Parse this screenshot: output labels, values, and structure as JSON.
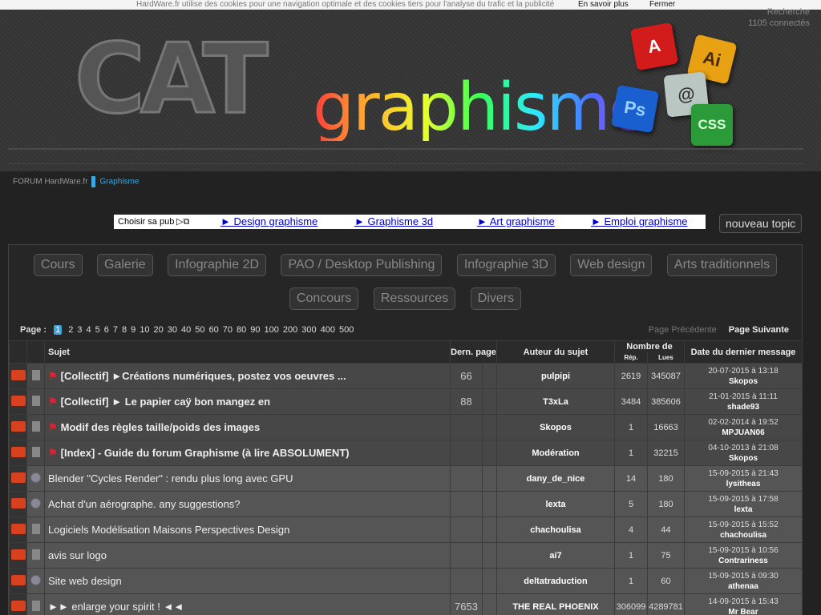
{
  "cookie": {
    "message": "HardWare.fr utilise des cookies pour une navigation optimale et des cookies tiers pour l'analyse du trafic et la publicité",
    "more_label": "En savoir plus",
    "close_label": "Fermer"
  },
  "ghost_nav": {
    "search": "Recherche",
    "connected": "1105 connectés"
  },
  "banner": {
    "logo_cat": "CAT",
    "logo_text": "graphisme",
    "tiles": {
      "pdf": "A",
      "ai": "Ai",
      "ps": "Ps",
      "three_d": "@",
      "css": "CSS"
    }
  },
  "breadcrumb": {
    "root": "FORUM HardWare.fr",
    "current": "Graphisme"
  },
  "pub": {
    "choose_label": "Choisir sa pub",
    "links": [
      "► Design graphisme",
      "► Graphisme 3d",
      "► Art graphisme",
      "► Emploi graphisme"
    ]
  },
  "new_topic_label": "nouveau topic",
  "categories": [
    "Cours",
    "Galerie",
    "Infographie 2D",
    "PAO / Desktop Publishing",
    "Infographie 3D",
    "Web design",
    "Arts traditionnels",
    "Concours",
    "Ressources",
    "Divers"
  ],
  "pagination": {
    "label": "Page :",
    "current": "1",
    "pages": [
      "2",
      "3",
      "4",
      "5",
      "6",
      "7",
      "8",
      "9",
      "10",
      "20",
      "30",
      "40",
      "50",
      "60",
      "70",
      "80",
      "90",
      "100",
      "200",
      "300",
      "400",
      "500"
    ],
    "prev_label": "Page Précédente",
    "next_label": "Page Suivante"
  },
  "table": {
    "headers": {
      "subject": "Sujet",
      "last_page": "Dern. page",
      "author": "Auteur du sujet",
      "count": "Nombre de",
      "replies": "Rép.",
      "reads": "Lues",
      "last_msg": "Date du dernier message"
    },
    "rows": [
      {
        "pinned": true,
        "subject": "[Collectif] ►Créations numériques, postez vos oeuvres ...",
        "last_page": "66",
        "author": "pulpipi",
        "replies": "2619",
        "reads": "345087",
        "date": "20-07-2015 à 13:18",
        "by": "Skopos"
      },
      {
        "pinned": true,
        "subject": "[Collectif] ► Le papier caÿ bon mangez en",
        "last_page": "88",
        "author": "T3xLa",
        "replies": "3484",
        "reads": "385606",
        "date": "21-01-2015 à 11:11",
        "by": "shade93"
      },
      {
        "pinned": true,
        "subject": "Modif des règles taille/poids des images",
        "last_page": "",
        "author": "Skopos",
        "replies": "1",
        "reads": "16663",
        "date": "02-02-2014 à 19:52",
        "by": "MPJUAN06"
      },
      {
        "pinned": true,
        "subject": "[Index] - Guide du forum Graphisme (à lire ABSOLUMENT)",
        "last_page": "",
        "author": "Modération",
        "replies": "1",
        "reads": "32215",
        "date": "04-10-2013 à 21:08",
        "by": "Skopos"
      },
      {
        "pinned": false,
        "subject": "Blender \"Cycles Render\" : rendu plus long avec GPU",
        "last_page": "",
        "author": "dany_de_nice",
        "replies": "14",
        "reads": "180",
        "date": "15-09-2015 à 21:43",
        "by": "lysitheas"
      },
      {
        "pinned": false,
        "subject": "Achat d'un aérographe. any suggestions?",
        "last_page": "",
        "author": "lexta",
        "replies": "5",
        "reads": "180",
        "date": "15-09-2015 à 17:58",
        "by": "lexta"
      },
      {
        "pinned": false,
        "subject": "Logiciels Modélisation Maisons Perspectives Design",
        "last_page": "",
        "author": "chachoulisa",
        "replies": "4",
        "reads": "44",
        "date": "15-09-2015 à 15:52",
        "by": "chachoulisa"
      },
      {
        "pinned": false,
        "subject": "avis sur logo",
        "last_page": "",
        "author": "ai7",
        "replies": "1",
        "reads": "75",
        "date": "15-09-2015 à 10:56",
        "by": "Contrariness"
      },
      {
        "pinned": false,
        "subject": "Site web design",
        "last_page": "",
        "author": "deltatraduction",
        "replies": "1",
        "reads": "60",
        "date": "15-09-2015 à 09:30",
        "by": "athenaa"
      },
      {
        "pinned": false,
        "subject": "►► enlarge your spirit ! ◄◄",
        "last_page": "7653",
        "author": "THE REAL PHOENIX",
        "replies": "306099",
        "reads": "4289781",
        "date": "14-09-2015 à 15:43",
        "by": "Mr Bear"
      }
    ]
  }
}
